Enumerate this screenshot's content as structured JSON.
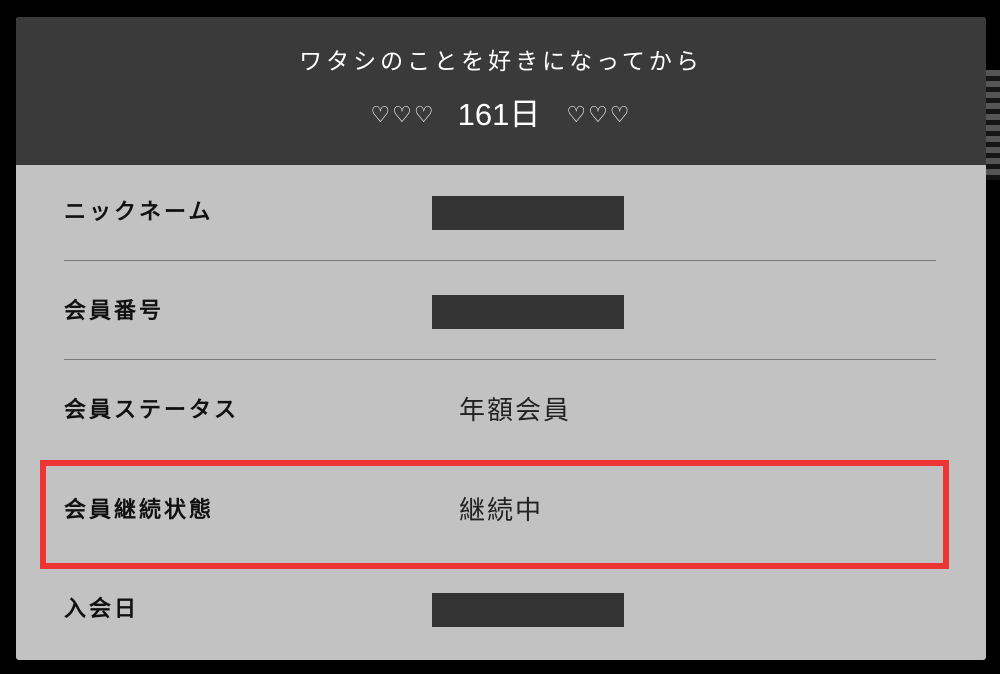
{
  "header": {
    "title": "ワタシのことを好きになってから",
    "hearts_left": "♡♡♡",
    "days": "161日",
    "hearts_right": "♡♡♡"
  },
  "rows": [
    {
      "label": "ニックネーム",
      "value": "",
      "redacted": true
    },
    {
      "label": "会員番号",
      "value": "",
      "redacted": true
    },
    {
      "label": "会員ステータス",
      "value": "年額会員",
      "redacted": false
    },
    {
      "label": "会員継続状態",
      "value": "継続中",
      "redacted": false,
      "highlighted": true
    },
    {
      "label": "入会日",
      "value": "",
      "redacted": true
    }
  ],
  "colors": {
    "header_bg": "#3a3a3a",
    "card_bg": "#c2c2c2",
    "highlight": "#ee3535",
    "redaction": "#333333"
  }
}
